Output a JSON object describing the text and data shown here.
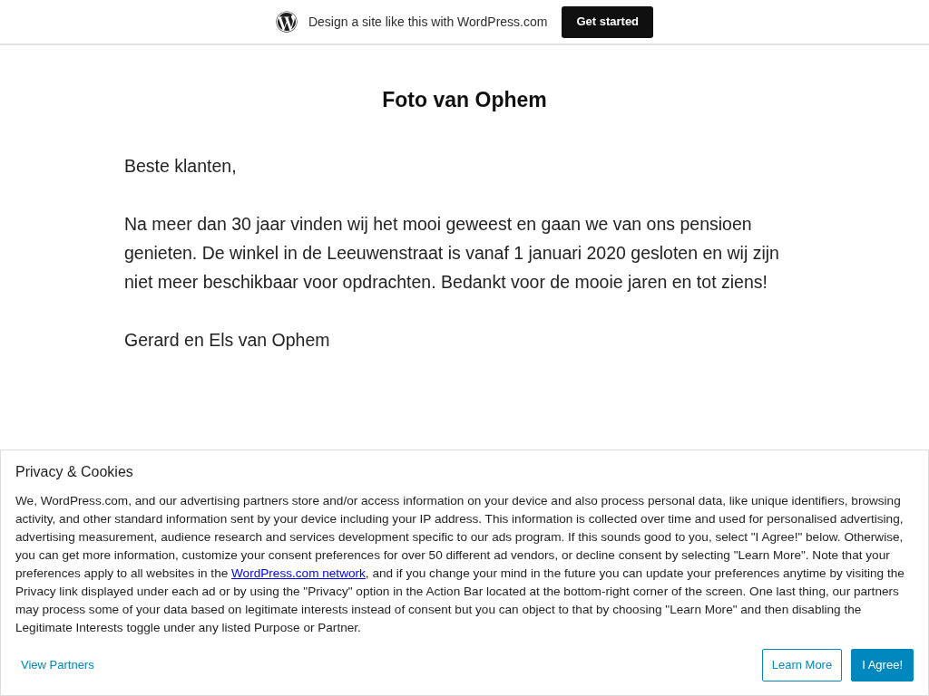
{
  "top_bar": {
    "text": "Design a site like this with WordPress.com",
    "button": "Get started"
  },
  "page": {
    "title": "Foto van Ophem",
    "paragraphs": [
      "Beste klanten,",
      "Na meer dan 30 jaar vinden wij het mooi geweest en gaan we van ons pensioen genieten. De winkel in de Leeuwenstraat is vanaf 1 januari 2020 gesloten en wij zijn niet meer beschikbaar voor opdrachten. Bedankt voor de mooie jaren en tot ziens!",
      "Gerard en Els van Ophem"
    ]
  },
  "cookie_banner": {
    "title": "Privacy & Cookies",
    "text_before": "We, WordPress.com, and our advertising partners store and/or access information on your device and also process personal data, like unique identifiers, browsing activity, and other standard information sent by your device including your IP address. This information is collected over time and used for personalised advertising, advertising measurement, audience research and services development specific to our ads program. If this sounds good to you, select \"I Agree!\" below. Otherwise, you can get more information, customize your consent preferences for over 50 different ad vendors, or decline consent by selecting \"Learn More\". Note that your preferences apply to all websites in the ",
    "link": "WordPress.com network",
    "text_after": ", and if you change your mind in the future you can update your preferences anytime by visiting the Privacy link displayed under each ad or by using the \"Privacy\" option in the Action Bar located at the bottom-right corner of the screen. One last thing, our partners may process some of your data based on legitimate interests instead of consent but you can object to that by choosing \"Learn More\" and then disabling the Legitimate Interests toggle under any listed Purpose or Partner.",
    "view_partners": "View Partners",
    "buttons": [
      {
        "label": "Learn More",
        "kind": "outline"
      },
      {
        "label": "I Agree!",
        "kind": "primary"
      }
    ]
  }
}
